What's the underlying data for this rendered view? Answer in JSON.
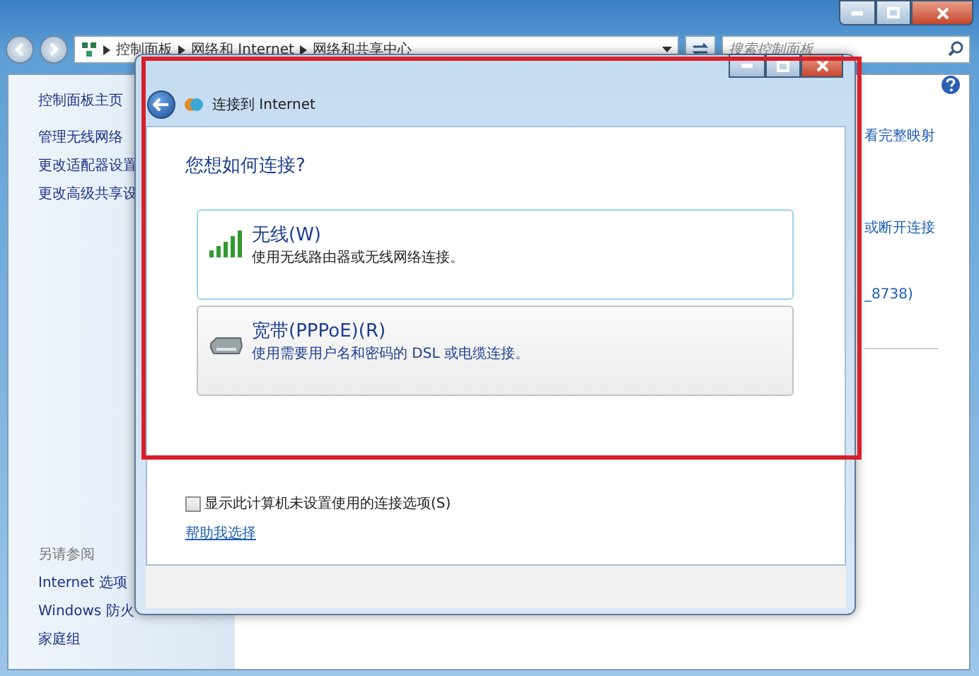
{
  "explorer": {
    "breadcrumb": [
      "控制面板",
      "网络和 Internet",
      "网络和共享中心"
    ],
    "search": {
      "placeholder": "搜索控制面板"
    },
    "sidebar": {
      "items": [
        "控制面板主页",
        "管理无线网络",
        "更改适配器设置",
        "更改高级共享设"
      ],
      "see_also_heading": "另请参阅",
      "see_also": [
        "Internet 选项",
        "Windows 防火",
        "家庭组"
      ]
    },
    "main_fragments": [
      "看完整映射",
      "或断开连接",
      "_8738)"
    ]
  },
  "dialog": {
    "title": "连接到 Internet",
    "question": "您想如何连接?",
    "options": [
      {
        "kind": "wireless",
        "title": "无线(W)",
        "description": "使用无线路由器或无线网络连接。",
        "selected": true
      },
      {
        "kind": "broadband",
        "title": "宽带(PPPoE)(R)",
        "description": "使用需要用户名和密码的 DSL 或电缆连接。",
        "selected": false
      }
    ],
    "checkbox": {
      "label": "显示此计算机未设置使用的连接选项(S)",
      "checked": false
    },
    "help_link": "帮助我选择"
  }
}
